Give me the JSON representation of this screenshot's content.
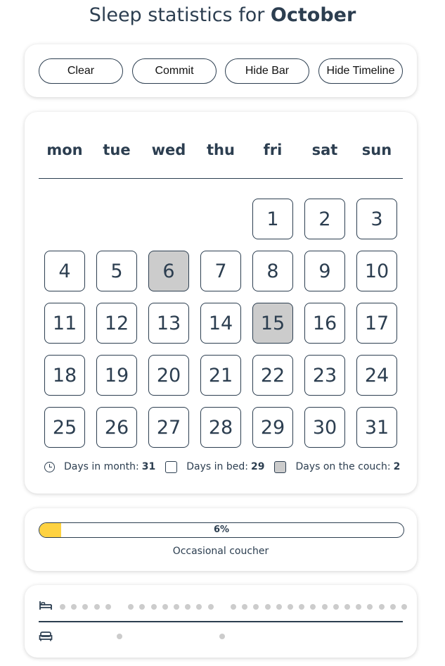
{
  "header": {
    "title_prefix": "Sleep statistics for ",
    "month": "October"
  },
  "toolbar": {
    "clear": "Clear",
    "commit": "Commit",
    "hide_bar": "Hide Bar",
    "hide_timeline": "Hide Timeline"
  },
  "calendar": {
    "weekdays": [
      "mon",
      "tue",
      "wed",
      "thu",
      "fri",
      "sat",
      "sun"
    ],
    "first_weekday_index": 4,
    "days_in_month": 31,
    "couch_days": [
      6,
      15
    ],
    "days": [
      "1",
      "2",
      "3",
      "4",
      "5",
      "6",
      "7",
      "8",
      "9",
      "10",
      "11",
      "12",
      "13",
      "14",
      "15",
      "16",
      "17",
      "18",
      "19",
      "20",
      "21",
      "22",
      "23",
      "24",
      "25",
      "26",
      "27",
      "28",
      "29",
      "30",
      "31"
    ]
  },
  "legend": {
    "days_in_month_label": "Days in month:",
    "days_in_month_value": "31",
    "days_in_bed_label": "Days in bed:",
    "days_in_bed_value": "29",
    "days_on_couch_label": "Days on the couch:",
    "days_on_couch_value": "2"
  },
  "progress": {
    "percent": 6,
    "percent_text": "6%",
    "label": "Occasional coucher",
    "fill_color": "#fed241"
  },
  "timeline": {
    "bed_icon": "bed-icon",
    "couch_icon": "couch-icon",
    "dot_color": "#cccccc"
  },
  "colors": {
    "text": "#2c3e50",
    "couch_day": "#cccccc"
  }
}
